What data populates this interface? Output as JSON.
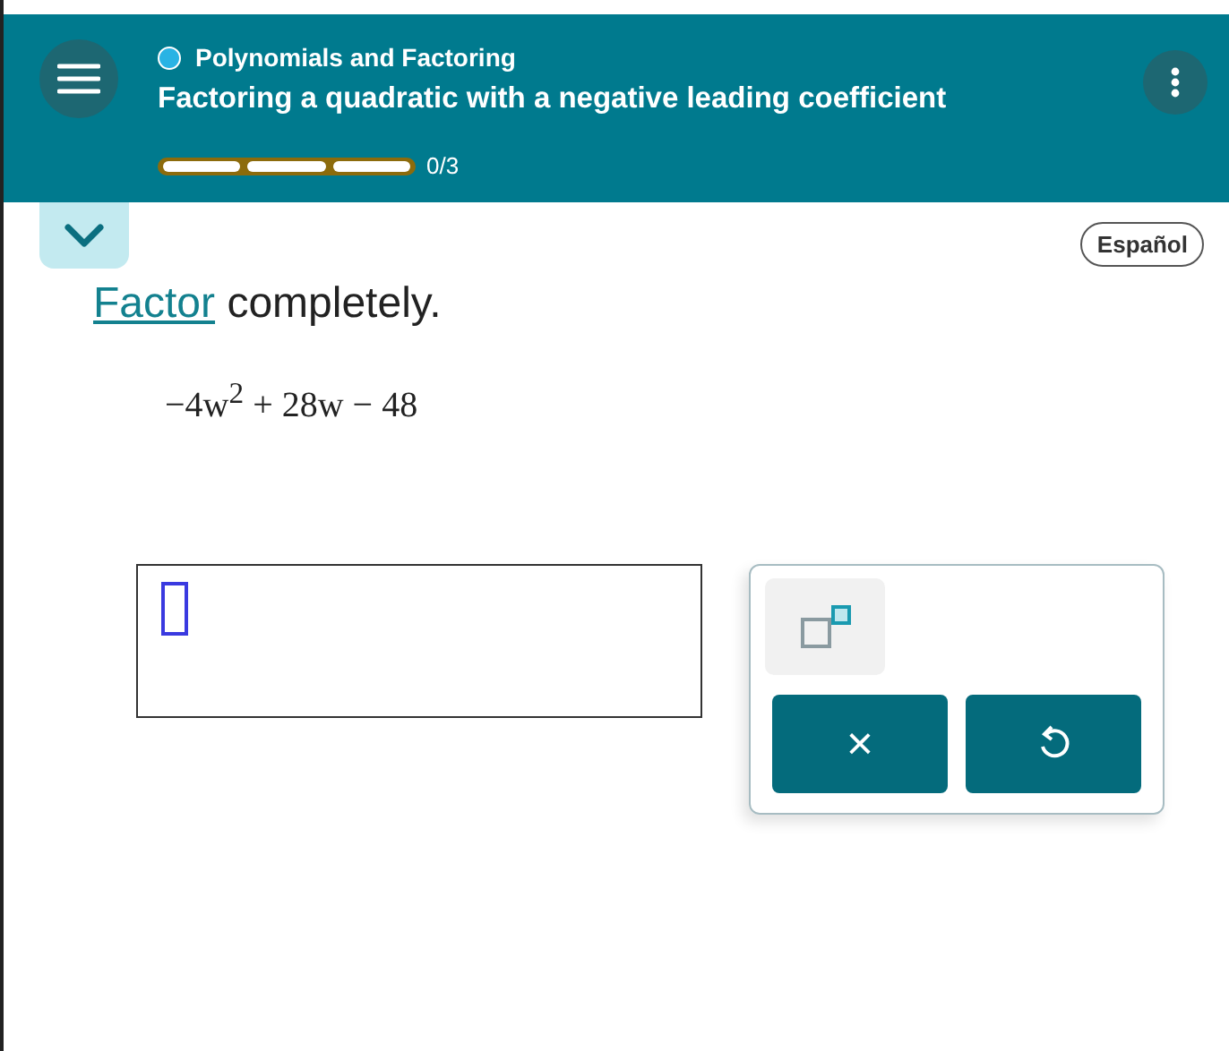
{
  "header": {
    "topic": "Polynomials and Factoring",
    "title": "Factoring a quadratic with a negative leading coefficient",
    "progress": {
      "segments": [
        {
          "filled": false
        },
        {
          "filled": false
        },
        {
          "filled": false
        }
      ],
      "text": "0/3"
    }
  },
  "language_button": "Español",
  "question": {
    "link": "Factor",
    "text": "completely.",
    "expression": "−4w$^{2}$ + 28w − 48"
  },
  "keypad": {
    "keys": [
      {
        "kind": "superscript"
      }
    ],
    "buttons": [
      {
        "kind": "clear",
        "label": "×"
      },
      {
        "kind": "undo"
      }
    ]
  }
}
